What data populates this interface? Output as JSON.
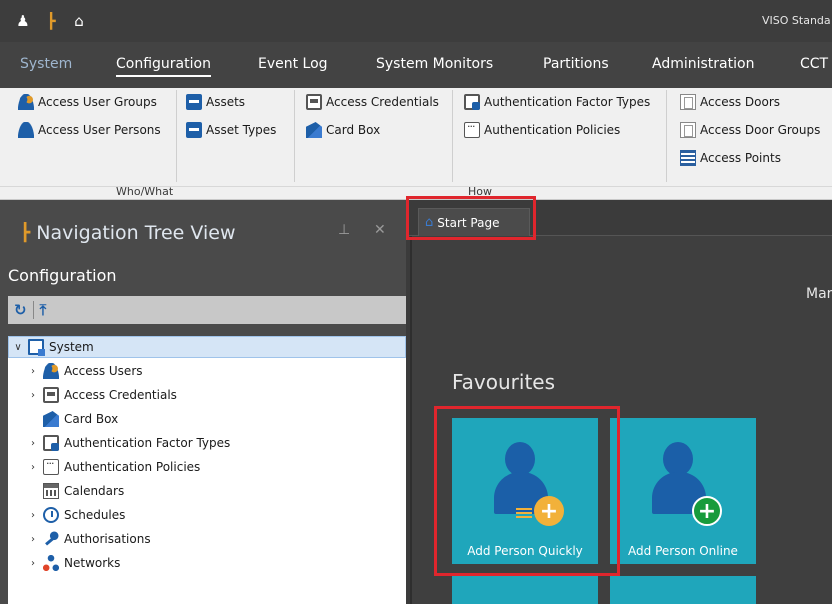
{
  "window": {
    "title": "VISO Standa"
  },
  "menu": {
    "items": [
      "System",
      "Configuration",
      "Event Log",
      "System Monitors",
      "Partitions",
      "Administration",
      "CCT"
    ],
    "active": "Configuration"
  },
  "ribbon": {
    "col1": [
      "Access User Groups",
      "Access User Persons"
    ],
    "col2": [
      "Assets",
      "Asset Types"
    ],
    "col3": [
      "Access Credentials",
      "Card Box"
    ],
    "col4": [
      "Authentication Factor Types",
      "Authentication Policies"
    ],
    "col5": [
      "Access Doors",
      "Access Door Groups",
      "Access Points"
    ],
    "groups": {
      "who_what": "Who/What",
      "how": "How"
    }
  },
  "nav": {
    "title": "Navigation Tree View",
    "section": "Configuration",
    "tree": [
      {
        "label": "System",
        "icon": "monitor-icon",
        "expanded": true,
        "selected": true
      },
      {
        "label": "Access Users",
        "icon": "users-icon"
      },
      {
        "label": "Access Credentials",
        "icon": "card-icon"
      },
      {
        "label": "Card Box",
        "icon": "card-box-icon"
      },
      {
        "label": "Authentication Factor Types",
        "icon": "factor-icon"
      },
      {
        "label": "Authentication Policies",
        "icon": "policy-icon"
      },
      {
        "label": "Calendars",
        "icon": "calendar-icon"
      },
      {
        "label": "Schedules",
        "icon": "clock-icon"
      },
      {
        "label": "Authorisations",
        "icon": "key-icon"
      },
      {
        "label": "Networks",
        "icon": "network-icon"
      }
    ]
  },
  "document": {
    "tab_label": "Start Page",
    "main_text": "Mar",
    "favourites_title": "Favourites",
    "tiles": [
      {
        "label": "Add Person Quickly",
        "badge": "orange-plus-icon"
      },
      {
        "label": "Add Person Online",
        "badge": "green-plus-icon"
      }
    ]
  },
  "colors": {
    "tile": "#1fa6bb",
    "highlight": "#e0262d",
    "accent": "#1e5fa8"
  }
}
